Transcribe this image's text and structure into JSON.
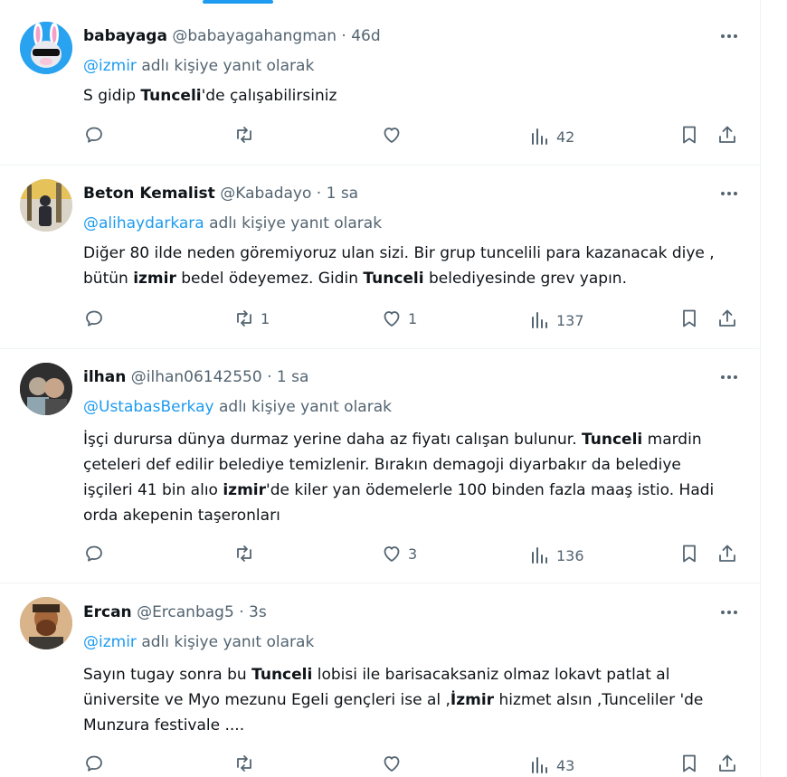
{
  "tweets": [
    {
      "name": "babayaga",
      "handle": "@babayagahangman",
      "dot": "·",
      "time": "46d",
      "reply_to": "@izmir",
      "reply_suffix": "adlı kişiye yanıt olarak",
      "body": [
        [
          "S gidip ",
          ""
        ],
        [
          "Tunceli",
          "b"
        ],
        [
          "'de çalışabilirsiniz",
          ""
        ]
      ],
      "replies": "",
      "retweets": "",
      "likes": "",
      "views": "42"
    },
    {
      "name": "Beton Kemalist",
      "handle": "@Kabadayo",
      "dot": "·",
      "time": "1 sa",
      "reply_to": "@alihaydarkara",
      "reply_suffix": "adlı kişiye yanıt olarak",
      "body": [
        [
          "Diğer 80 ilde neden göremiyoruz ulan sizi. Bir grup tuncelili para kazanacak diye , bütün ",
          ""
        ],
        [
          "izmir",
          "b"
        ],
        [
          " bedel ödeyemez. Gidin ",
          ""
        ],
        [
          "Tunceli",
          "b"
        ],
        [
          " belediyesinde grev yapın.",
          ""
        ]
      ],
      "replies": "",
      "retweets": "1",
      "likes": "1",
      "views": "137"
    },
    {
      "name": "ilhan",
      "handle": "@ilhan06142550",
      "dot": "·",
      "time": "1 sa",
      "reply_to": "@UstabasBerkay",
      "reply_suffix": "adlı kişiye yanıt olarak",
      "body": [
        [
          "İşçi durursa dünya durmaz yerine daha az fiyatı calışan bulunur. ",
          ""
        ],
        [
          "Tunceli",
          "b"
        ],
        [
          " mardin çeteleri def edilir belediye temizlenir. Bırakın demagoji diyarbakır da belediye işçileri 41 bin alıo ",
          ""
        ],
        [
          "izmir",
          "b"
        ],
        [
          "'de kiler yan ödemelerle 100 binden fazla maaş istio. Hadi orda  akepenin taşeronları",
          ""
        ]
      ],
      "replies": "",
      "retweets": "",
      "likes": "3",
      "views": "136"
    },
    {
      "name": "Ercan",
      "handle": "@Ercanbag5",
      "dot": "·",
      "time": "3s",
      "reply_to": "@izmir",
      "reply_suffix": "adlı kişiye yanıt olarak",
      "body": [
        [
          "Sayın tugay sonra bu ",
          ""
        ],
        [
          "Tunceli",
          "b"
        ],
        [
          " lobisi ile barisacaksaniz  olmaz lokavt patlat al üniversite ve Myo mezunu Egeli gençleri ise al ,",
          ""
        ],
        [
          "İzmir",
          "b"
        ],
        [
          " hizmet alsın ,Tunceliler 'de Munzura festivale ....",
          ""
        ]
      ],
      "replies": "",
      "retweets": "",
      "likes": "",
      "views": "43"
    }
  ],
  "icons": {
    "reply": "comment-icon",
    "retweet": "retweet-icon",
    "like": "heart-icon",
    "views": "views-icon",
    "bookmark": "bookmark-icon",
    "share": "share-icon",
    "more": "more-icon"
  },
  "colors": {
    "accent": "#1d9bf0",
    "text": "#0f1419",
    "secondary": "#536471",
    "border": "#eff3f4"
  }
}
